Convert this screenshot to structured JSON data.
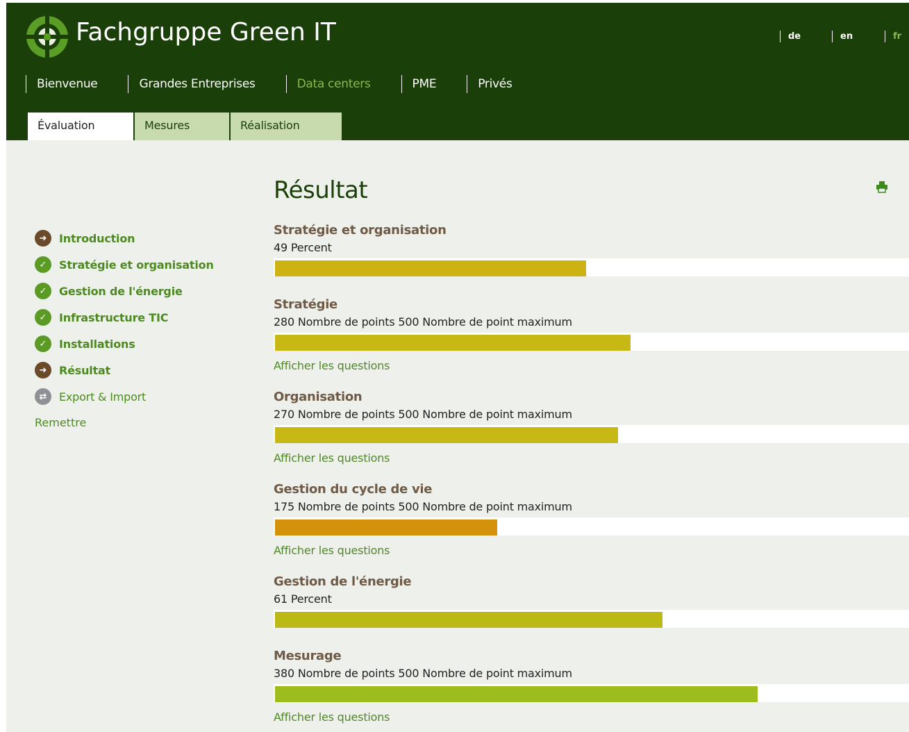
{
  "header": {
    "brand": "Fachgruppe Green IT",
    "languages": [
      "de",
      "en",
      "fr"
    ],
    "active_language": "fr"
  },
  "mainnav": [
    "Bienvenue",
    "Grandes Entreprises",
    "Data centers",
    "PME",
    "Privés"
  ],
  "mainnav_active": "Data centers",
  "tabs": [
    "Évaluation",
    "Mesures",
    "Réalisation"
  ],
  "tabs_active": "Évaluation",
  "sidebar": {
    "items": [
      {
        "label": "Introduction",
        "icon": "arrow-right-icon"
      },
      {
        "label": "Stratégie et organisation",
        "icon": "check-icon"
      },
      {
        "label": "Gestion de l'énergie",
        "icon": "check-icon"
      },
      {
        "label": "Infrastructure TIC",
        "icon": "check-icon"
      },
      {
        "label": "Installations",
        "icon": "check-icon"
      },
      {
        "label": "Résultat",
        "icon": "arrow-right-icon"
      },
      {
        "label": "Export & Import",
        "icon": "exchange-icon"
      }
    ],
    "reset": "Remettre"
  },
  "main": {
    "title": "Résultat",
    "print_icon": "print-icon",
    "show_questions": "Afficher les questions",
    "sections": [
      {
        "title": "Stratégie et organisation",
        "sub": "49 Percent",
        "fraction": 0.49,
        "color": "#cdb214",
        "show": false
      },
      {
        "title": "Stratégie",
        "sub": "280 Nombre de points 500 Nombre de point maximum",
        "fraction": 0.56,
        "color": "#c8b816",
        "show": true
      },
      {
        "title": "Organisation",
        "sub": "270 Nombre de points 500 Nombre de point maximum",
        "fraction": 0.54,
        "color": "#c8b816",
        "show": true
      },
      {
        "title": "Gestion du cycle de vie",
        "sub": "175 Nombre de points 500 Nombre de point maximum",
        "fraction": 0.35,
        "color": "#d4910b",
        "show": true
      },
      {
        "title": "Gestion de l'énergie",
        "sub": "61 Percent",
        "fraction": 0.61,
        "color": "#bcb917",
        "show": false
      },
      {
        "title": "Mesurage",
        "sub": "380 Nombre de points 500 Nombre de point maximum",
        "fraction": 0.76,
        "color": "#9dbd1f",
        "show": true
      }
    ]
  }
}
